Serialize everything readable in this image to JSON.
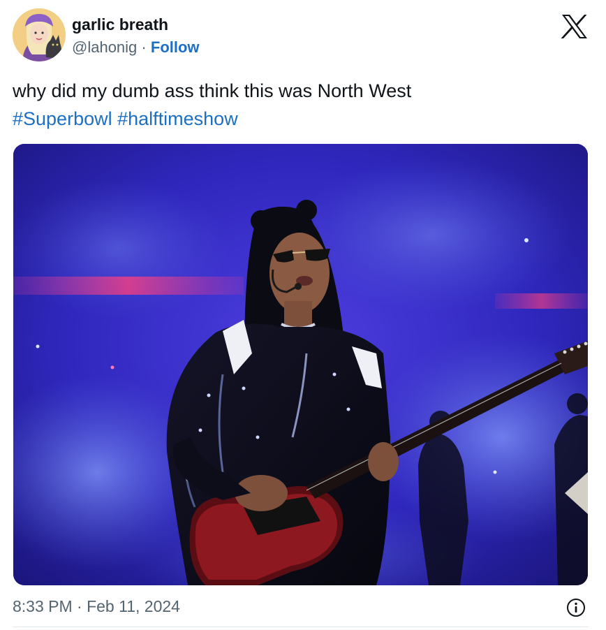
{
  "author": {
    "display_name": "garlic breath",
    "handle": "@lahonig",
    "separator": "·",
    "follow_label": "Follow"
  },
  "tweet": {
    "text": "why did my dumb ass think this was North West",
    "hashtags": [
      "#Superbowl",
      "#halftimeshow"
    ],
    "timestamp": "8:33 PM · Feb 11, 2024"
  },
  "icons": {
    "brand": "x-logo-icon",
    "info": "info-icon"
  },
  "colors": {
    "link": "#1d6fc4",
    "text": "#0f1419",
    "muted": "#536471"
  }
}
